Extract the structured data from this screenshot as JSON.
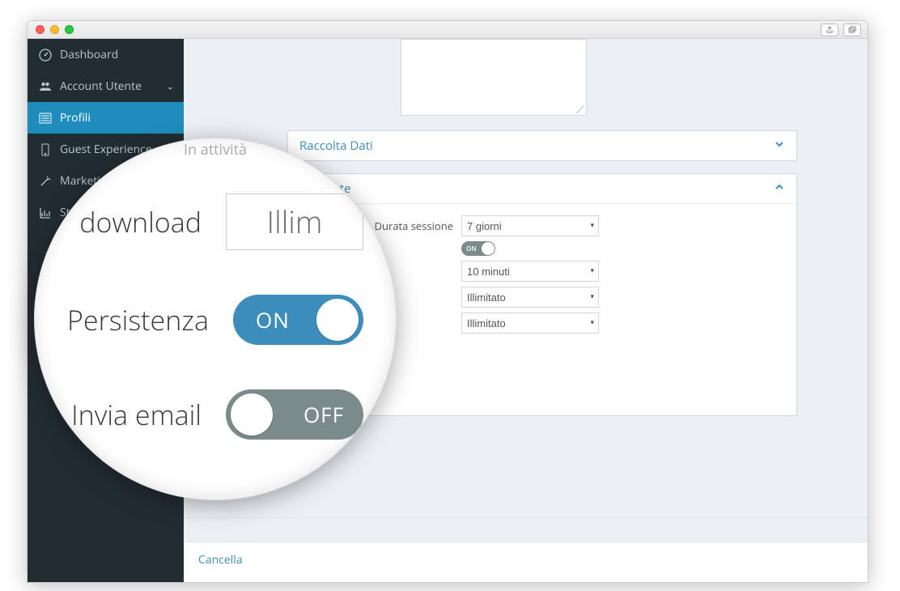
{
  "sidebar": {
    "items": [
      {
        "label": "Dashboard",
        "icon": "dashboard-icon"
      },
      {
        "label": "Account Utente",
        "icon": "users-icon",
        "expandable": true
      },
      {
        "label": "Profili",
        "icon": "list-icon",
        "active": true
      },
      {
        "label": "Guest Experience",
        "icon": "tablet-icon",
        "expandable": true
      },
      {
        "label": "Marketing",
        "icon": "wand-icon"
      },
      {
        "label": "Strumenti",
        "icon": "chart-icon"
      }
    ]
  },
  "panels": {
    "raccolta": {
      "title": "Raccolta Dati"
    },
    "avanzate": {
      "title": "Avanzate",
      "fields": {
        "durata_sessione": {
          "label": "Durata sessione",
          "value": "7 giorni"
        },
        "mini_toggle_label": "ON",
        "tempo": {
          "value": "10 minuti"
        },
        "download": {
          "value": "Illimitato"
        },
        "upload": {
          "value": "Illimitato"
        }
      }
    }
  },
  "bottombar": {
    "cancel": "Cancella"
  },
  "lens": {
    "faded_top": "In attività",
    "download": {
      "label": "download",
      "value": "Illim"
    },
    "persistenza": {
      "label": "Persistenza",
      "toggle": "ON"
    },
    "invia_email": {
      "label": "Invia email",
      "toggle": "OFF"
    }
  }
}
